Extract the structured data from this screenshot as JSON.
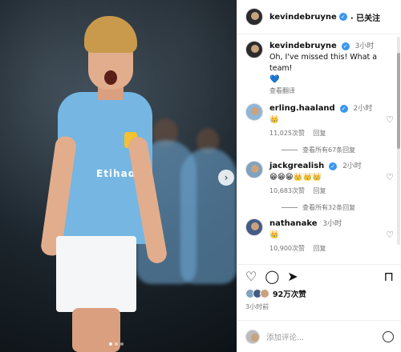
{
  "post": {
    "author": "kevindebruyne",
    "follow_label": "· 已关注",
    "more_label": "···",
    "caption": "Oh, I've missed this! What a team!",
    "caption_emoji": "💙",
    "caption_time": "3小时",
    "translate_label": "查看翻译",
    "sponsor_text": "Etihad",
    "carousel_next": "›"
  },
  "comments": [
    {
      "user": "erling.haaland",
      "time": "2小时",
      "text": "👑",
      "likes": "11,025次赞",
      "reply_label": "回复",
      "view_replies": "查看所有67条回复"
    },
    {
      "user": "jackgrealish",
      "time": "2小时",
      "text": "😁😁😁👑👑👑",
      "likes": "10,683次赞",
      "reply_label": "回复",
      "view_replies": "查看所有32条回复"
    },
    {
      "user": "nathanake",
      "time": "3小时",
      "text": "👑",
      "likes": "10,900次赞",
      "reply_label": "回复",
      "view_replies": ""
    }
  ],
  "footer": {
    "likes": "92万次赞",
    "time_ago": "3小时前",
    "add_comment_placeholder": "添加评论..."
  },
  "colors": {
    "verified": "#3897f0",
    "jersey": "#75b6e3"
  }
}
